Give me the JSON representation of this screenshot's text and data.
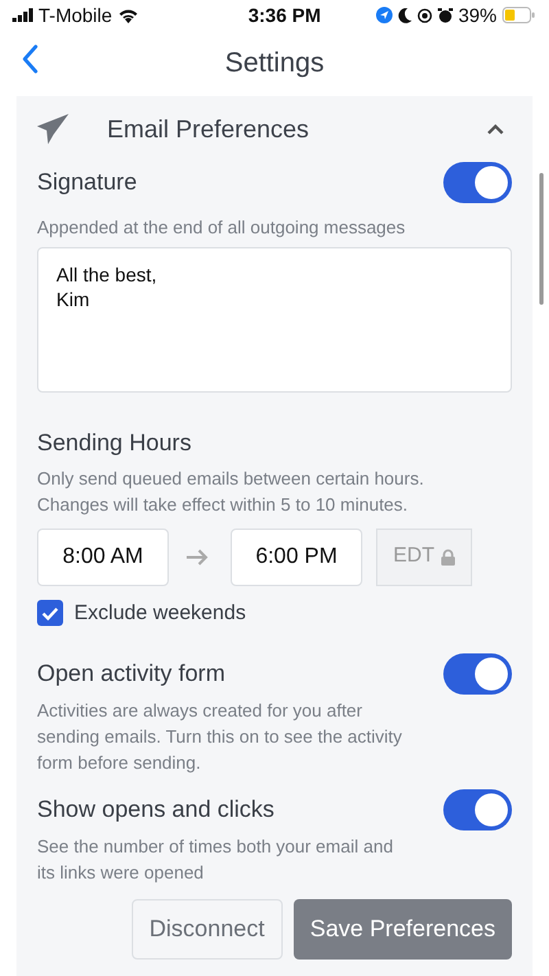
{
  "status_bar": {
    "carrier": "T-Mobile",
    "time": "3:36 PM",
    "battery": "39%"
  },
  "nav": {
    "title": "Settings"
  },
  "section": {
    "title": "Email Preferences",
    "expanded": true
  },
  "signature": {
    "label": "Signature",
    "on": true,
    "description": "Appended at the end of all outgoing messages",
    "value": "All the best,\nKim"
  },
  "sending_hours": {
    "label": "Sending Hours",
    "description": "Only send queued emails between certain hours. Changes will take effect within 5 to 10 minutes.",
    "start": "8:00 AM",
    "end": "6:00 PM",
    "timezone": "EDT",
    "exclude_weekends": {
      "label": "Exclude weekends",
      "checked": true
    }
  },
  "toggles": [
    {
      "label": "Open activity form",
      "on": true,
      "description": "Activities are always created for you after sending emails. Turn this on to see the activity form before sending."
    },
    {
      "label": "Show opens and clicks",
      "on": true,
      "description": "See the number of times both your email and its links were opened"
    }
  ],
  "buttons": [
    {
      "label": "Disconnect",
      "kind": "outline"
    },
    {
      "label": "Save Preferences",
      "kind": "primary"
    }
  ]
}
